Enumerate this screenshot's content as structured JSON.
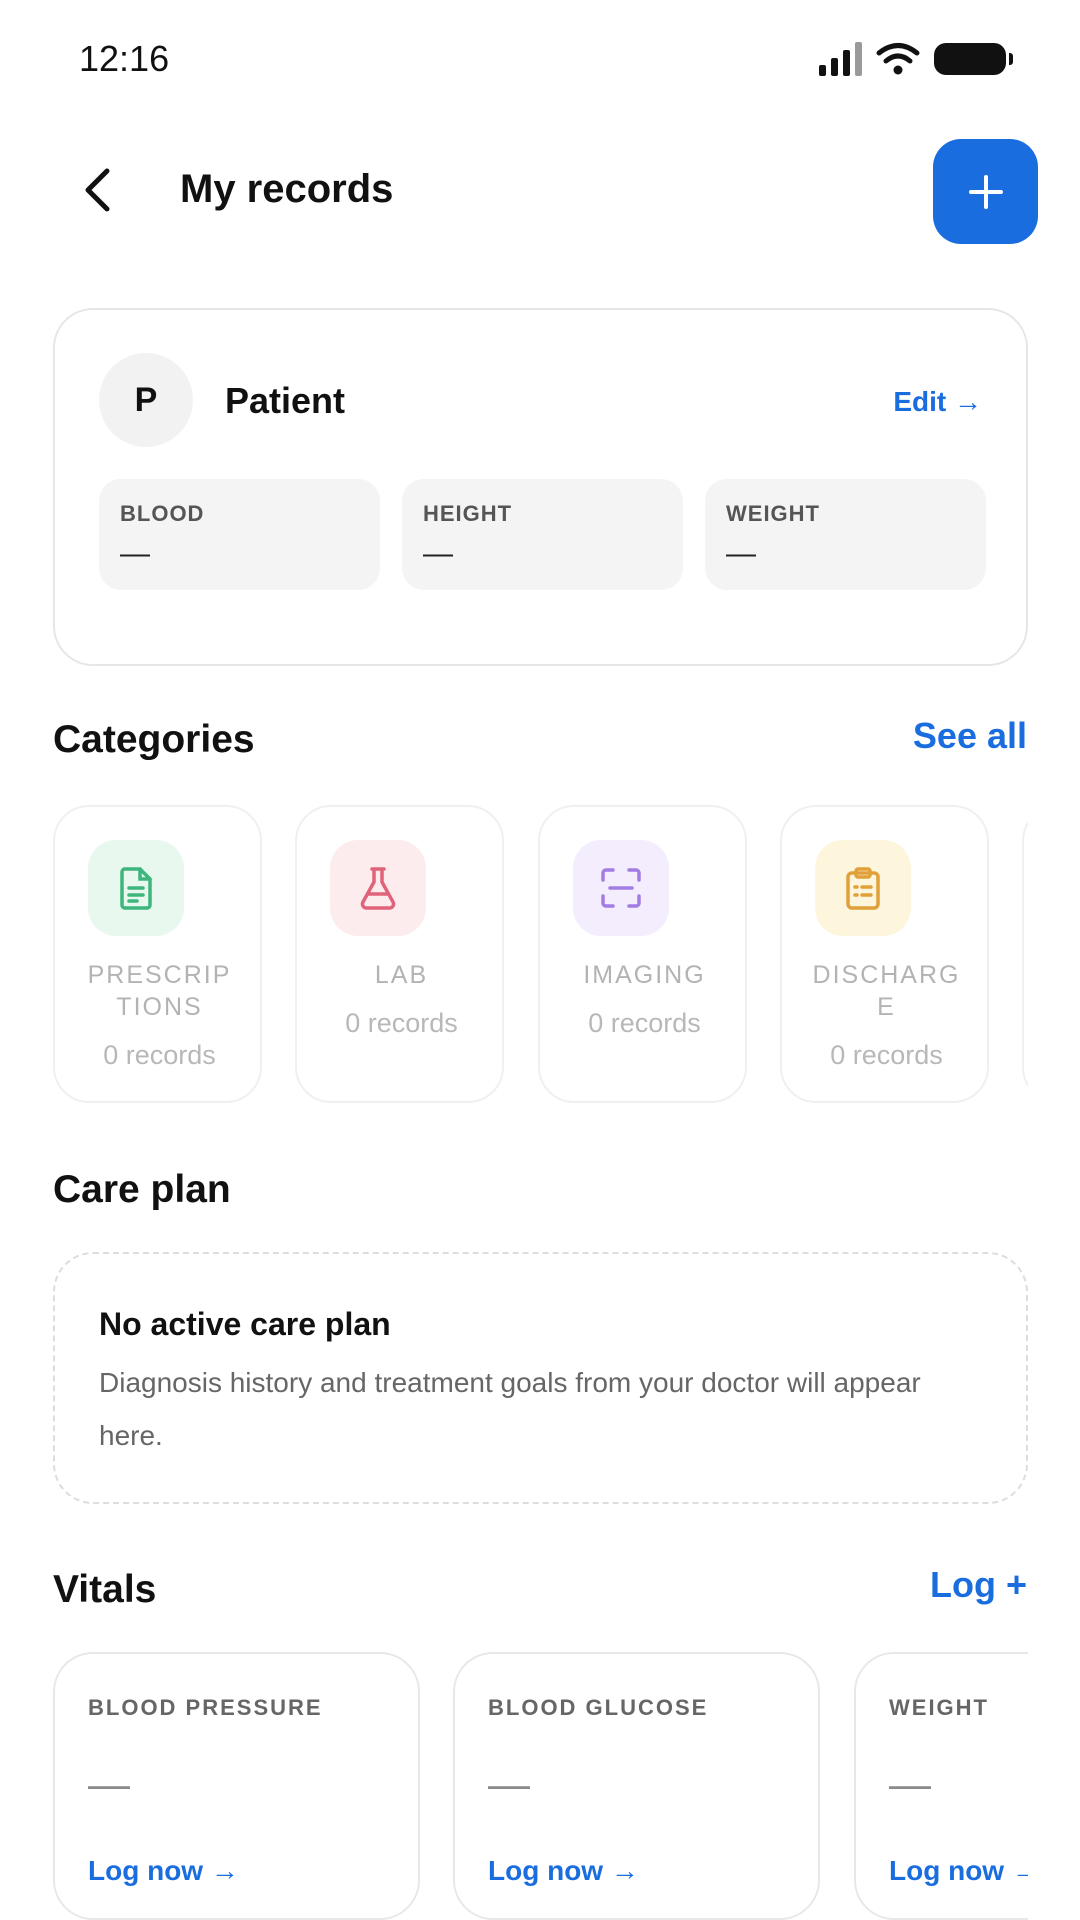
{
  "status_bar": {
    "time": "12:16",
    "icons": [
      "cellular-signal-icon",
      "wifi-icon",
      "battery-icon"
    ]
  },
  "header": {
    "back_icon": "chevron-left-icon",
    "title": "My records",
    "add_icon": "plus-icon",
    "accent_color": "#1a6ddf"
  },
  "patient": {
    "initial": "P",
    "name": "Patient",
    "edit_label": "Edit →",
    "stats": [
      {
        "label": "BLOOD",
        "value": "—"
      },
      {
        "label": "HEIGHT",
        "value": "—"
      },
      {
        "label": "WEIGHT",
        "value": "—"
      }
    ]
  },
  "categories": {
    "title": "Categories",
    "see_all_label": "See all",
    "items": [
      {
        "name": "PRESCRIP\nTIONS",
        "count": "0 records",
        "icon": "document-icon",
        "icon_bg": "#e8f8ef",
        "icon_color": "#3fb57e"
      },
      {
        "name": "LAB",
        "count": "0 records",
        "icon": "flask-icon",
        "icon_bg": "#fdecee",
        "icon_color": "#e0637a"
      },
      {
        "name": "IMAGING",
        "count": "0 records",
        "icon": "scan-icon",
        "icon_bg": "#f3edfd",
        "icon_color": "#a47de3"
      },
      {
        "name": "DISCHARG\nE",
        "count": "0 records",
        "icon": "clipboard-icon",
        "icon_bg": "#fef6dc",
        "icon_color": "#e0a13a"
      }
    ]
  },
  "care_plan": {
    "title": "Care plan",
    "empty_title": "No active care plan",
    "empty_description": "Diagnosis history and treatment goals from your doctor will appear here."
  },
  "vitals": {
    "title": "Vitals",
    "log_label": "Log +",
    "items": [
      {
        "label": "BLOOD PRESSURE",
        "value": "—",
        "action": "Log now →"
      },
      {
        "label": "BLOOD GLUCOSE",
        "value": "—",
        "action": "Log now →"
      },
      {
        "label": "WEIGHT",
        "value": "—",
        "action": "Log now →"
      }
    ]
  }
}
